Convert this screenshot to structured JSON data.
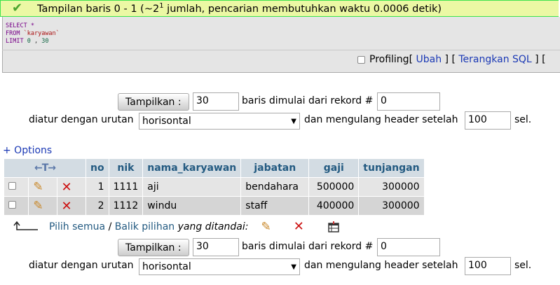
{
  "result": {
    "message": "Tampilan baris 0 - 1 (~2",
    "message_sup": "1",
    "message_tail": " jumlah, pencarian membutuhkan waktu 0.0006 detik)"
  },
  "sql": {
    "line1_kw": "SELECT",
    "line1_rest": " *",
    "line2_kw": "FROM",
    "line2_table": " `karyawan`",
    "line3_kw": "LIMIT",
    "line3_a": " 0",
    "line3_sep": " , ",
    "line3_b": "30"
  },
  "sql_actions": {
    "profiling": "Profiling",
    "open": "[ ",
    "edit": "Ubah",
    "mid": " ] [ ",
    "explain": "Terangkan SQL",
    "close": " ] ["
  },
  "nav_top": {
    "show_button": "Tampilkan :",
    "rows_value": "30",
    "start_label": "baris dimulai dari rekord #",
    "start_value": "0",
    "order_label": "diatur dengan urutan",
    "order_value": "horisontal",
    "repeat_label": "dan mengulang header setelah",
    "repeat_value": "100",
    "cells_label": "sel."
  },
  "nav_bottom": {
    "show_button": "Tampilkan :",
    "rows_value": "30",
    "start_label": "baris dimulai dari rekord #",
    "start_value": "0",
    "order_label": "diatur dengan urutan",
    "order_value": "horisontal",
    "repeat_label": "dan mengulang header setelah",
    "repeat_value": "100",
    "cells_label": "sel."
  },
  "options_link": "+ Options",
  "table": {
    "arrows": "←T→",
    "columns": [
      "no",
      "nik",
      "nama_karyawan",
      "jabatan",
      "gaji",
      "tunjangan"
    ],
    "rows": [
      {
        "no": "1",
        "nik": "1111",
        "nama_karyawan": "aji",
        "jabatan": "bendahara",
        "gaji": "500000",
        "tunjangan": "300000"
      },
      {
        "no": "2",
        "nik": "1112",
        "nama_karyawan": "windu",
        "jabatan": "staff",
        "gaji": "400000",
        "tunjangan": "300000"
      }
    ]
  },
  "bulk": {
    "select_all": "Pilih semua",
    "separator": " / ",
    "invert": "Balik pilihan",
    "with_selected": " yang ditandai:"
  },
  "colors": {
    "success_bg": "#ebf8a4",
    "success_border": "#3ee34e",
    "header_bg": "#d3dce3",
    "link": "#235a81"
  }
}
